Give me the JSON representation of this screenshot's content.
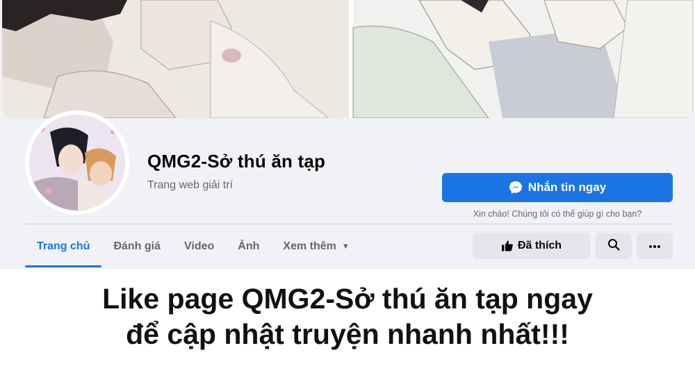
{
  "page": {
    "name": "QMG2-Sở thú ăn tạp",
    "category": "Trang web giải trí"
  },
  "actions": {
    "message_label": "Nhắn tin ngay",
    "greeting": "Xin chào! Chúng tôi có thể giúp gì cho bạn?",
    "liked_label": "Đã thích"
  },
  "tabs": [
    {
      "label": "Trang chủ",
      "active": true
    },
    {
      "label": "Đánh giá"
    },
    {
      "label": "Video"
    },
    {
      "label": "Ảnh"
    },
    {
      "label": "Xem thêm"
    }
  ],
  "caption": {
    "line1": "Like page QMG2-Sở thú ăn tạp ngay",
    "line2": "để cập nhật truyện nhanh nhất!!!"
  },
  "colors": {
    "accent": "#1b74e4",
    "button_gray": "#e4e6eb",
    "panel_bg": "#f0f2f5"
  },
  "icons": [
    "messenger-icon",
    "thumbs-up-icon",
    "search-icon",
    "more-icon",
    "caret-down-icon"
  ]
}
